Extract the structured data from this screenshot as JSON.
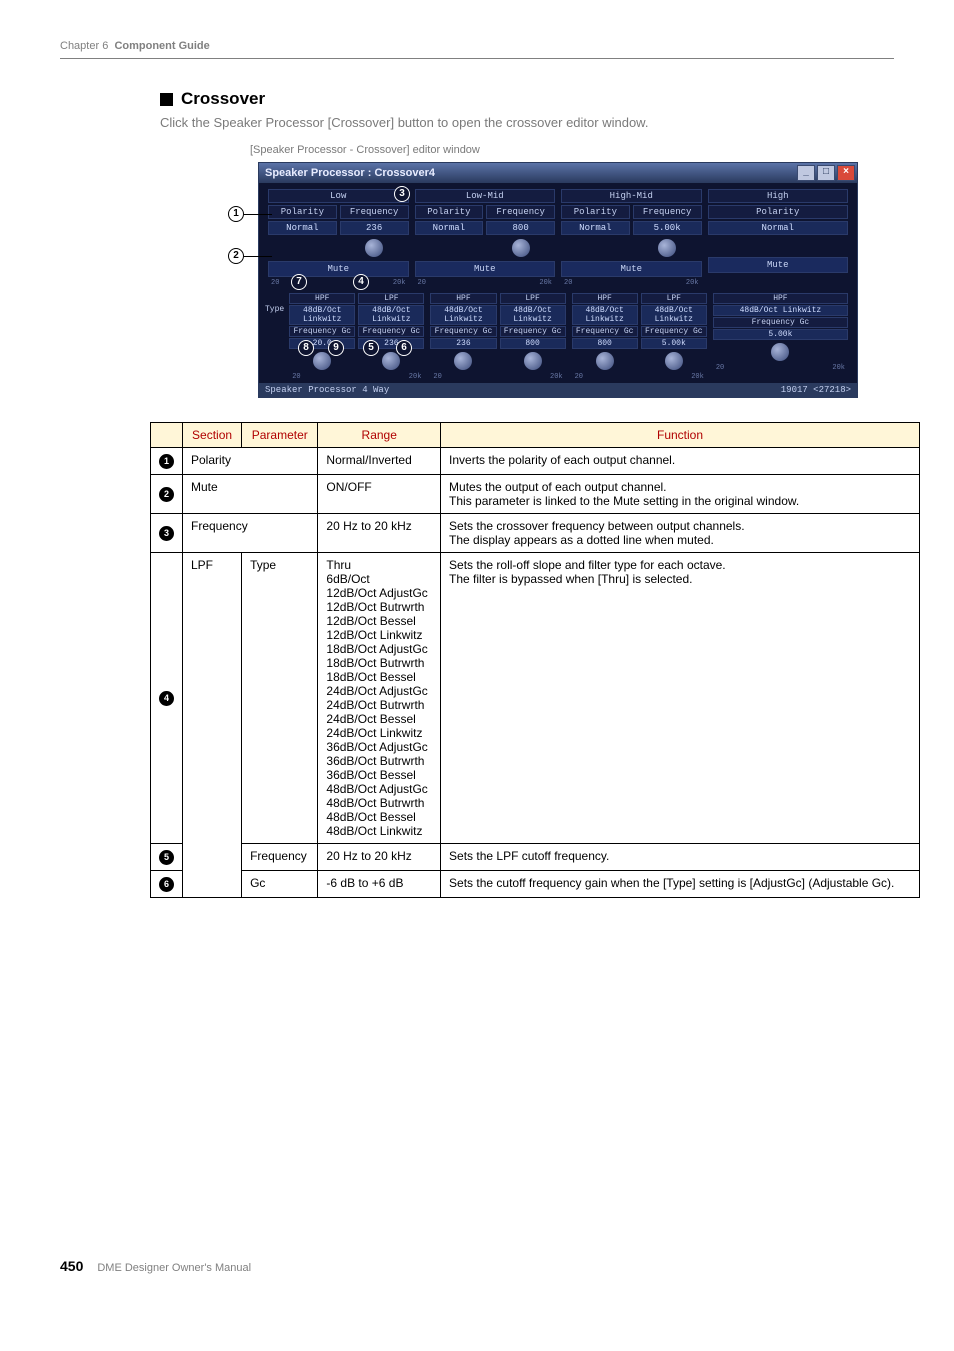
{
  "header": {
    "chapter": "Chapter 6",
    "title": "Component Guide"
  },
  "section": {
    "title": "Crossover",
    "desc": "Click the Speaker Processor [Crossover] button to open the crossover editor window.",
    "caption": "[Speaker Processor - Crossover] editor window"
  },
  "editor": {
    "window_title": "Speaker Processor : Crossover4",
    "bands": [
      "Low",
      "Low-Mid",
      "High-Mid",
      "High"
    ],
    "labels": {
      "polarity": "Polarity",
      "frequency": "Frequency",
      "mute": "Mute",
      "normal": "Normal",
      "type": "Type",
      "hpf": "HPF",
      "lpf": "LPF",
      "gc": "Gc"
    },
    "top_freq": [
      "236",
      "800",
      "5.00k"
    ],
    "filter_type": "48dB/Oct Linkwitz",
    "bottom_freq": [
      "20.0",
      "236",
      "236",
      "800",
      "800",
      "5.00k",
      "5.00k"
    ],
    "scale_lo": "20",
    "scale_hi": "20k",
    "status_left": "Speaker Processor  4 Way",
    "status_right": "19017 <27218>"
  },
  "callouts": [
    "1",
    "2",
    "3",
    "4",
    "5",
    "6",
    "7",
    "8",
    "9"
  ],
  "table": {
    "headers": [
      "Section",
      "Parameter",
      "Range",
      "Function"
    ],
    "rows": [
      {
        "idx": "1",
        "section": "Polarity",
        "parameter": "",
        "merge_sp": true,
        "range": "Normal/Inverted",
        "function": "Inverts the polarity of each output channel."
      },
      {
        "idx": "2",
        "section": "Mute",
        "parameter": "",
        "merge_sp": true,
        "range": "ON/OFF",
        "function": "Mutes the output of each output channel.\nThis parameter is linked to the Mute setting in the original window."
      },
      {
        "idx": "3",
        "section": "Frequency",
        "parameter": "",
        "merge_sp": true,
        "range": "20 Hz to 20 kHz",
        "function": "Sets the crossover frequency between output channels.\nThe display appears as a dotted line when muted."
      },
      {
        "idx": "4",
        "section": "LPF",
        "parameter": "Type",
        "range": "Thru\n6dB/Oct\n12dB/Oct AdjustGc\n12dB/Oct Butrwrth\n12dB/Oct Bessel\n12dB/Oct Linkwitz\n18dB/Oct AdjustGc\n18dB/Oct Butrwrth\n18dB/Oct Bessel\n24dB/Oct AdjustGc\n24dB/Oct Butrwrth\n24dB/Oct Bessel\n24dB/Oct Linkwitz\n36dB/Oct AdjustGc\n36dB/Oct Butrwrth\n36dB/Oct Bessel\n48dB/Oct AdjustGc\n48dB/Oct Butrwrth\n48dB/Oct Bessel\n48dB/Oct Linkwitz",
        "function": "Sets the roll-off slope and filter type for each octave.\nThe filter is bypassed when [Thru] is selected."
      },
      {
        "idx": "5",
        "section": "",
        "parameter": "Frequency",
        "range": "20 Hz to 20 kHz",
        "function": "Sets the LPF cutoff frequency."
      },
      {
        "idx": "6",
        "section": "",
        "parameter": "Gc",
        "range": "-6 dB to +6 dB",
        "function": "Sets the cutoff frequency gain when the [Type] setting is [AdjustGc] (Adjustable Gc)."
      }
    ]
  },
  "footer": {
    "page": "450",
    "manual": "DME Designer Owner's Manual"
  }
}
